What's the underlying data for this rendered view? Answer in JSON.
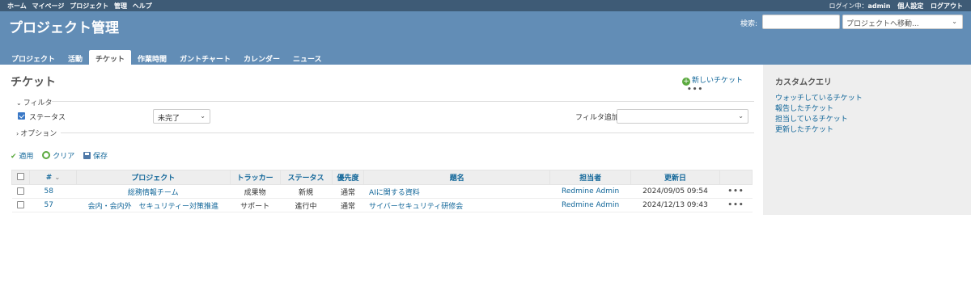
{
  "top_menu": {
    "left": [
      "ホーム",
      "マイページ",
      "プロジェクト",
      "管理",
      "ヘルプ"
    ],
    "login_label": "ログイン中：",
    "user": "admin",
    "personal_settings": "個人設定",
    "logout": "ログアウト"
  },
  "header": {
    "title": "プロジェクト管理",
    "search_label": "検索:",
    "search_value": "",
    "jump_placeholder": "プロジェクトへ移動...",
    "tabs": [
      "プロジェクト",
      "活動",
      "チケット",
      "作業時間",
      "ガントチャート",
      "カレンダー",
      "ニュース"
    ],
    "selected_tab": "チケット"
  },
  "main": {
    "title": "チケット",
    "new_issue": "新しいチケット",
    "more": "•••",
    "filter_legend": "フィルタ",
    "status_filter_label": "ステータス",
    "status_filter_value": "未完了",
    "add_filter_label": "フィルタ追加",
    "add_filter_value": "",
    "options_legend": "オプション",
    "apply": "適用",
    "clear": "クリア",
    "save": "保存"
  },
  "issues_table": {
    "columns": [
      "#",
      "プロジェクト",
      "トラッカー",
      "ステータス",
      "優先度",
      "題名",
      "担当者",
      "更新日"
    ],
    "rows": [
      {
        "id": "58",
        "project": "総務情報チーム",
        "tracker": "成果物",
        "status": "新規",
        "priority": "通常",
        "subject": "AIに関する資料",
        "assigned": "Redmine Admin",
        "updated": "2024/09/05 09:54"
      },
      {
        "id": "57",
        "project": "会内・会内外　セキュリティー対策推進",
        "tracker": "サポート",
        "status": "進行中",
        "priority": "通常",
        "subject": "サイバーセキュリティ研修会",
        "assigned": "Redmine Admin",
        "updated": "2024/12/13 09:43"
      }
    ]
  },
  "sidebar": {
    "title": "カスタムクエリ",
    "links": [
      "ウォッチしているチケット",
      "報告したチケット",
      "担当しているチケット",
      "更新したチケット"
    ]
  },
  "colors": {
    "top_menu_bg": "#3e5b76",
    "header_bg": "#628db6",
    "link": "#169",
    "sidebar_bg": "#eeeeee"
  }
}
